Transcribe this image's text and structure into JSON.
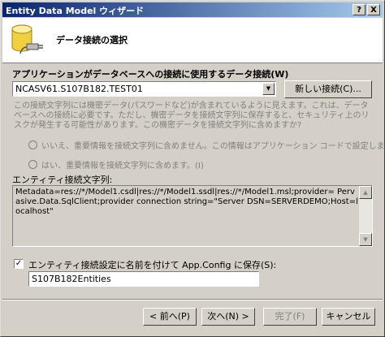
{
  "window": {
    "title": "Entity Data Model ウィザード",
    "help_label": "?",
    "close_label": "X"
  },
  "header": {
    "title": "データ接続の選択",
    "icon": "database-connection-icon"
  },
  "connection": {
    "label": "アプリケーションがデータベースへの接続に使用するデータ接続(W)",
    "selected": "NCASV61.S107B182.TEST01",
    "new_button": "新しい接続(C)..."
  },
  "sensitive": {
    "info_text": "この接続文字列には機密データ(パスワードなど)が含まれているように見えます。これは、データベースへの接続に必要です。ただし、機密データを接続文字列に保存すると、セキュリティ上のリスクが発生する可能性があります。この機密データを接続文字列に含めますか?",
    "exclude_option": "いいえ、重要情報を接続文字列に含めません。この情報はアプリケーション コードで設定します。",
    "include_option": "はい、重要情報を接続文字列に含めます。(I)"
  },
  "entity_connection": {
    "label": "エンティティ接続文字列:",
    "value": "Metadata=res://*/Model1.csdl|res://*/Model1.ssdl|res://*/Model1.msl;provider= Pervasive.Data.SqlClient;provider connection string=\"Server DSN=SERVERDEMO;Host=localhost\""
  },
  "save": {
    "checked": true,
    "check_mark": "✓",
    "label": "エンティティ接続設定に名前を付けて App.Config に保存(S):",
    "value": "S107B182Entities"
  },
  "footer": {
    "back": "< 前へ(P)",
    "next": "次へ(N) >",
    "finish": "完了(F)",
    "cancel": "キャンセル"
  },
  "colors": {
    "title_gradient_start": "#0a246a",
    "title_gradient_end": "#a6caf0",
    "face": "#d4d0c8"
  }
}
